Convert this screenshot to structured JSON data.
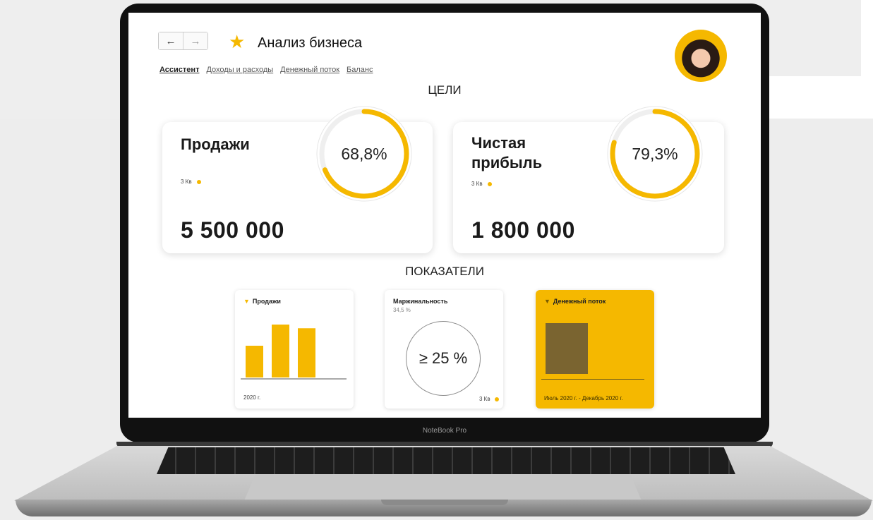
{
  "window": {
    "title": "Анализ бизнеса",
    "back_icon": "←",
    "forward_icon": "→",
    "favorite_icon": "★"
  },
  "tabs": [
    {
      "label": "Ассистент",
      "active": true
    },
    {
      "label": "Доходы и расходы",
      "active": false
    },
    {
      "label": "Денежный поток",
      "active": false
    },
    {
      "label": "Баланс",
      "active": false
    }
  ],
  "goals": {
    "heading": "ЦЕЛИ",
    "cards": [
      {
        "title_line1": "Продажи",
        "title_line2": "",
        "period": "3 Кв",
        "value": "5 500 000",
        "progress_text": "68,8%",
        "progress": 0.688
      },
      {
        "title_line1": "Чистая",
        "title_line2": "прибыль",
        "period": "3 Кв",
        "value": "1 800 000",
        "progress_text": "79,3%",
        "progress": 0.793
      }
    ]
  },
  "indicators": {
    "heading": "ПОКАЗАТЕЛИ",
    "sales": {
      "title": "Продажи",
      "year": "2020 г.",
      "bars": [
        0.6,
        1.0,
        0.93
      ]
    },
    "margin": {
      "title": "Маржинальность",
      "current": "34,5 %",
      "target": "≥ 25 %",
      "period": "3 Кв"
    },
    "cashflow": {
      "title": "Денежный поток",
      "period": "Июль 2020 г. - Декабрь 2020 г."
    }
  },
  "device": {
    "label": "NoteBook Pro"
  },
  "colors": {
    "accent": "#f5b800",
    "ring_track": "#eeeeee",
    "cash_block": "#7a6430"
  }
}
